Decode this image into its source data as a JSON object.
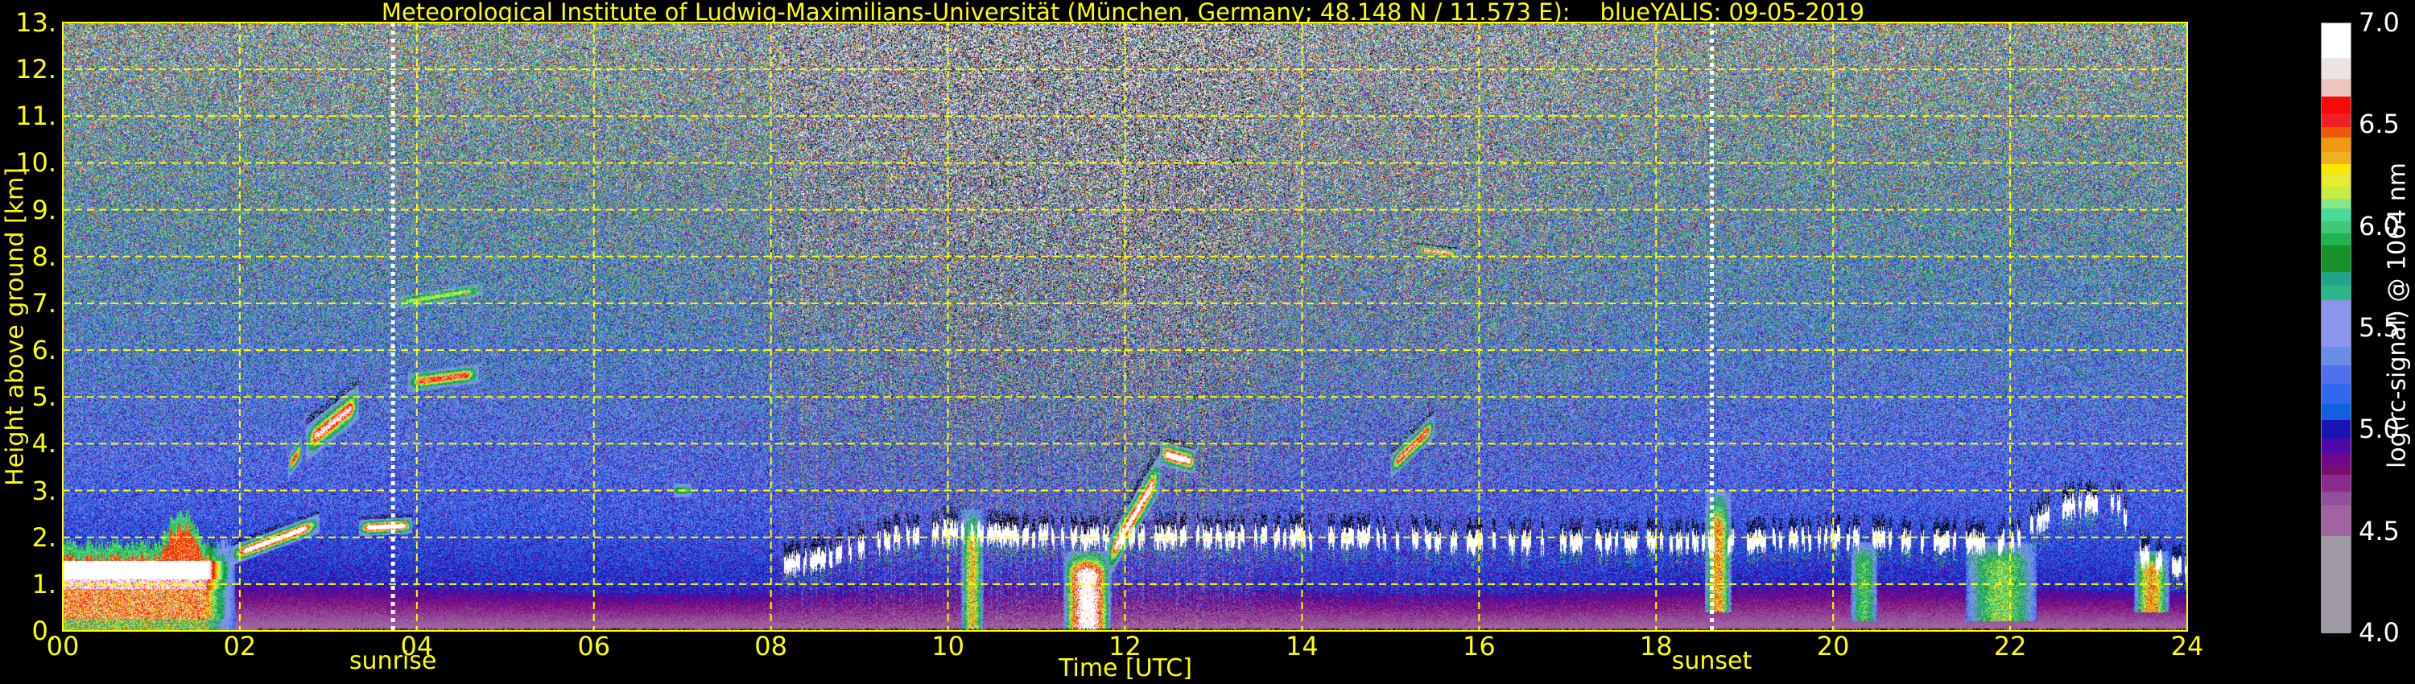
{
  "chart_data": {
    "type": "heatmap",
    "title": "Meteorological Institute of Ludwig-Maximilians-Universität (München, Germany; 48.148 N / 11.573 E):    blueYALIS: 09-05-2019",
    "xlabel": "Time [UTC]",
    "ylabel": "Height above ground [km]",
    "colorbar_label": "log(rc-signal) @ 1064 nm",
    "x_range": [
      0,
      24
    ],
    "y_range": [
      0,
      13
    ],
    "x_ticks": [
      {
        "value": 0,
        "label": "00"
      },
      {
        "value": 2,
        "label": "02"
      },
      {
        "value": 4,
        "label": "04"
      },
      {
        "value": 6,
        "label": "06"
      },
      {
        "value": 8,
        "label": "08"
      },
      {
        "value": 10,
        "label": "10"
      },
      {
        "value": 12,
        "label": "12"
      },
      {
        "value": 14,
        "label": "14"
      },
      {
        "value": 16,
        "label": "16"
      },
      {
        "value": 18,
        "label": "18"
      },
      {
        "value": 20,
        "label": "20"
      },
      {
        "value": 22,
        "label": "22"
      },
      {
        "value": 24,
        "label": "24"
      }
    ],
    "y_ticks": [
      {
        "value": 0,
        "label": "0."
      },
      {
        "value": 1,
        "label": "1."
      },
      {
        "value": 2,
        "label": "2."
      },
      {
        "value": 3,
        "label": "3."
      },
      {
        "value": 4,
        "label": "4."
      },
      {
        "value": 5,
        "label": "5."
      },
      {
        "value": 6,
        "label": "6."
      },
      {
        "value": 7,
        "label": "7."
      },
      {
        "value": 8,
        "label": "8."
      },
      {
        "value": 9,
        "label": "9."
      },
      {
        "value": 10,
        "label": "10."
      },
      {
        "value": 11,
        "label": "11."
      },
      {
        "value": 12,
        "label": "12."
      },
      {
        "value": 13,
        "label": "13."
      }
    ],
    "grid": true,
    "grid_color": "#ffff00",
    "colorbar_range": [
      4.0,
      7.0
    ],
    "colorbar_ticks": [
      {
        "value": 4.0,
        "label": "4.0"
      },
      {
        "value": 4.5,
        "label": "4.5"
      },
      {
        "value": 5.0,
        "label": "5.0"
      },
      {
        "value": 5.5,
        "label": "5.5"
      },
      {
        "value": 6.0,
        "label": "6.0"
      },
      {
        "value": 6.5,
        "label": "6.5"
      },
      {
        "value": 7.0,
        "label": "7.0"
      }
    ],
    "color_levels": [
      {
        "from": 4.0,
        "to": 4.48,
        "color": "#a09aa4"
      },
      {
        "from": 4.48,
        "to": 4.63,
        "color": "#a065a0"
      },
      {
        "from": 4.63,
        "to": 4.7,
        "color": "#93509a"
      },
      {
        "from": 4.7,
        "to": 4.78,
        "color": "#8a2a8e"
      },
      {
        "from": 4.78,
        "to": 4.83,
        "color": "#7a0e6e"
      },
      {
        "from": 4.83,
        "to": 4.89,
        "color": "#70088e"
      },
      {
        "from": 4.89,
        "to": 4.96,
        "color": "#5008a8"
      },
      {
        "from": 4.96,
        "to": 5.05,
        "color": "#1a14b4"
      },
      {
        "from": 5.05,
        "to": 5.13,
        "color": "#1060e0"
      },
      {
        "from": 5.13,
        "to": 5.23,
        "color": "#3068f0"
      },
      {
        "from": 5.23,
        "to": 5.32,
        "color": "#5070ec"
      },
      {
        "from": 5.32,
        "to": 5.41,
        "color": "#6a8ee8"
      },
      {
        "from": 5.41,
        "to": 5.64,
        "color": "#8a96ec"
      },
      {
        "from": 5.64,
        "to": 5.71,
        "color": "#2ab88a"
      },
      {
        "from": 5.71,
        "to": 5.78,
        "color": "#22a488"
      },
      {
        "from": 5.78,
        "to": 5.91,
        "color": "#17922a"
      },
      {
        "from": 5.91,
        "to": 5.97,
        "color": "#1fb450"
      },
      {
        "from": 5.97,
        "to": 6.03,
        "color": "#40c878"
      },
      {
        "from": 6.03,
        "to": 6.09,
        "color": "#48dc98"
      },
      {
        "from": 6.09,
        "to": 6.14,
        "color": "#88e888"
      },
      {
        "from": 6.14,
        "to": 6.2,
        "color": "#c8ec40"
      },
      {
        "from": 6.2,
        "to": 6.26,
        "color": "#e8ec30"
      },
      {
        "from": 6.26,
        "to": 6.31,
        "color": "#ffe800"
      },
      {
        "from": 6.31,
        "to": 6.37,
        "color": "#f0b020"
      },
      {
        "from": 6.37,
        "to": 6.44,
        "color": "#f09810"
      },
      {
        "from": 6.44,
        "to": 6.49,
        "color": "#f05808"
      },
      {
        "from": 6.49,
        "to": 6.56,
        "color": "#f02020"
      },
      {
        "from": 6.56,
        "to": 6.64,
        "color": "#f80808"
      },
      {
        "from": 6.64,
        "to": 6.73,
        "color": "#ecc4c0"
      },
      {
        "from": 6.73,
        "to": 6.83,
        "color": "#ece4e0"
      },
      {
        "from": 6.83,
        "to": 7.0,
        "color": "#ffffff"
      }
    ],
    "annotations": [
      {
        "label": "sunrise",
        "time": 3.73
      },
      {
        "label": "sunset",
        "time": 18.63
      }
    ],
    "residual_layer_night": {
      "time_range": [
        0.0,
        1.95
      ],
      "core_height_km": [
        1.1,
        1.5
      ],
      "top_km": 1.85
    },
    "cloud_layer": {
      "time": [
        8.1,
        8.5,
        9.0,
        9.5,
        10.0,
        11.0,
        12.5,
        13.5,
        14.5,
        16.0,
        17.0,
        18.0,
        19.0,
        20.0,
        21.0,
        22.0,
        22.5,
        23.2,
        23.5,
        24.0
      ],
      "height_km": [
        1.4,
        1.5,
        1.8,
        2.0,
        2.1,
        2.0,
        2.0,
        2.0,
        2.0,
        1.9,
        1.9,
        1.9,
        1.9,
        2.0,
        1.9,
        1.9,
        2.6,
        2.8,
        1.6,
        1.3
      ]
    },
    "features": [
      {
        "kind": "layer",
        "t0": 1.9,
        "t1": 2.9,
        "h0": 1.6,
        "h1": 2.3,
        "thickness_km": 0.12,
        "peak": 7.0
      },
      {
        "kind": "layer",
        "t0": 2.55,
        "t1": 2.7,
        "h0": 3.5,
        "h1": 3.9,
        "thickness_km": 0.15,
        "peak": 6.5
      },
      {
        "kind": "layer",
        "t0": 2.75,
        "t1": 3.35,
        "h0": 4.0,
        "h1": 4.9,
        "thickness_km": 0.22,
        "peak": 6.8
      },
      {
        "kind": "layer",
        "t0": 3.35,
        "t1": 3.95,
        "h0": 2.2,
        "h1": 2.25,
        "thickness_km": 0.1,
        "peak": 7.1
      },
      {
        "kind": "layer",
        "t0": 3.9,
        "t1": 4.7,
        "h0": 5.3,
        "h1": 5.5,
        "thickness_km": 0.12,
        "peak": 6.6
      },
      {
        "kind": "layer",
        "t0": 3.75,
        "t1": 4.75,
        "h0": 7.0,
        "h1": 7.3,
        "thickness_km": 0.08,
        "peak": 6.2
      },
      {
        "kind": "layer",
        "t0": 6.9,
        "t1": 7.1,
        "h0": 3.0,
        "h1": 3.0,
        "thickness_km": 0.08,
        "peak": 6.0
      },
      {
        "kind": "column",
        "t0": 10.15,
        "t1": 10.4,
        "h0": 0.0,
        "h1": 2.6,
        "peak": 6.3
      },
      {
        "kind": "column",
        "t0": 11.3,
        "t1": 11.85,
        "h0": 0.0,
        "h1": 1.7,
        "peak": 7.0
      },
      {
        "kind": "layer",
        "t0": 11.8,
        "t1": 12.4,
        "h0": 1.5,
        "h1": 3.4,
        "thickness_km": 0.25,
        "peak": 6.9
      },
      {
        "kind": "layer",
        "t0": 12.4,
        "t1": 12.8,
        "h0": 3.8,
        "h1": 3.6,
        "thickness_km": 0.15,
        "peak": 7.0
      },
      {
        "kind": "layer",
        "t0": 15.0,
        "t1": 15.5,
        "h0": 3.5,
        "h1": 4.4,
        "thickness_km": 0.15,
        "peak": 6.7
      },
      {
        "kind": "layer",
        "t0": 15.3,
        "t1": 15.75,
        "h0": 8.15,
        "h1": 8.05,
        "thickness_km": 0.06,
        "peak": 6.8
      },
      {
        "kind": "column",
        "t0": 18.55,
        "t1": 18.85,
        "h0": 0.4,
        "h1": 3.0,
        "peak": 6.4
      },
      {
        "kind": "column",
        "t0": 20.2,
        "t1": 20.5,
        "h0": 0.2,
        "h1": 1.9,
        "peak": 6.0
      },
      {
        "kind": "column",
        "t0": 21.5,
        "t1": 22.3,
        "h0": 0.2,
        "h1": 1.9,
        "peak": 6.1
      },
      {
        "kind": "column",
        "t0": 23.4,
        "t1": 23.8,
        "h0": 0.4,
        "h1": 1.7,
        "peak": 6.4
      }
    ]
  }
}
